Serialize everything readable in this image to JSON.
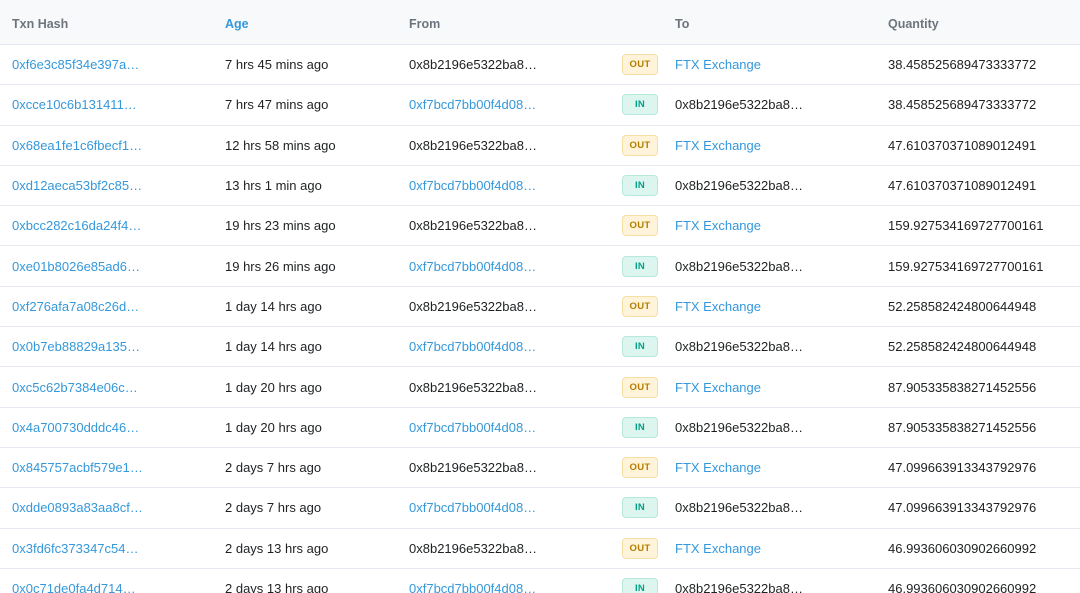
{
  "header": {
    "txn_hash": "Txn Hash",
    "age": "Age",
    "from": "From",
    "to": "To",
    "quantity": "Quantity"
  },
  "colors": {
    "link": "#3498db",
    "out_badge": "#b47d00",
    "in_badge": "#00a186"
  },
  "rows": [
    {
      "hash": "0xf6e3c85f34e397a…",
      "age": "7 hrs 45 mins ago",
      "from": "0x8b2196e5322ba8…",
      "from_link": false,
      "dir": "OUT",
      "to": "FTX Exchange",
      "to_link": true,
      "qty": "38.458525689473333772"
    },
    {
      "hash": "0xcce10c6b131411…",
      "age": "7 hrs 47 mins ago",
      "from": "0xf7bcd7bb00f4d08…",
      "from_link": true,
      "dir": "IN",
      "to": "0x8b2196e5322ba8…",
      "to_link": false,
      "qty": "38.458525689473333772"
    },
    {
      "hash": "0x68ea1fe1c6fbecf1…",
      "age": "12 hrs 58 mins ago",
      "from": "0x8b2196e5322ba8…",
      "from_link": false,
      "dir": "OUT",
      "to": "FTX Exchange",
      "to_link": true,
      "qty": "47.610370371089012491"
    },
    {
      "hash": "0xd12aeca53bf2c85…",
      "age": "13 hrs 1 min ago",
      "from": "0xf7bcd7bb00f4d08…",
      "from_link": true,
      "dir": "IN",
      "to": "0x8b2196e5322ba8…",
      "to_link": false,
      "qty": "47.610370371089012491"
    },
    {
      "hash": "0xbcc282c16da24f4…",
      "age": "19 hrs 23 mins ago",
      "from": "0x8b2196e5322ba8…",
      "from_link": false,
      "dir": "OUT",
      "to": "FTX Exchange",
      "to_link": true,
      "qty": "159.927534169727700161"
    },
    {
      "hash": "0xe01b8026e85ad6…",
      "age": "19 hrs 26 mins ago",
      "from": "0xf7bcd7bb00f4d08…",
      "from_link": true,
      "dir": "IN",
      "to": "0x8b2196e5322ba8…",
      "to_link": false,
      "qty": "159.927534169727700161"
    },
    {
      "hash": "0xf276afa7a08c26d…",
      "age": "1 day 14 hrs ago",
      "from": "0x8b2196e5322ba8…",
      "from_link": false,
      "dir": "OUT",
      "to": "FTX Exchange",
      "to_link": true,
      "qty": "52.258582424800644948"
    },
    {
      "hash": "0x0b7eb88829a135…",
      "age": "1 day 14 hrs ago",
      "from": "0xf7bcd7bb00f4d08…",
      "from_link": true,
      "dir": "IN",
      "to": "0x8b2196e5322ba8…",
      "to_link": false,
      "qty": "52.258582424800644948"
    },
    {
      "hash": "0xc5c62b7384e06c…",
      "age": "1 day 20 hrs ago",
      "from": "0x8b2196e5322ba8…",
      "from_link": false,
      "dir": "OUT",
      "to": "FTX Exchange",
      "to_link": true,
      "qty": "87.905335838271452556"
    },
    {
      "hash": "0x4a700730dddc46…",
      "age": "1 day 20 hrs ago",
      "from": "0xf7bcd7bb00f4d08…",
      "from_link": true,
      "dir": "IN",
      "to": "0x8b2196e5322ba8…",
      "to_link": false,
      "qty": "87.905335838271452556"
    },
    {
      "hash": "0x845757acbf579e1…",
      "age": "2 days 7 hrs ago",
      "from": "0x8b2196e5322ba8…",
      "from_link": false,
      "dir": "OUT",
      "to": "FTX Exchange",
      "to_link": true,
      "qty": "47.099663913343792976"
    },
    {
      "hash": "0xdde0893a83aa8cf…",
      "age": "2 days 7 hrs ago",
      "from": "0xf7bcd7bb00f4d08…",
      "from_link": true,
      "dir": "IN",
      "to": "0x8b2196e5322ba8…",
      "to_link": false,
      "qty": "47.099663913343792976"
    },
    {
      "hash": "0x3fd6fc373347c54…",
      "age": "2 days 13 hrs ago",
      "from": "0x8b2196e5322ba8…",
      "from_link": false,
      "dir": "OUT",
      "to": "FTX Exchange",
      "to_link": true,
      "qty": "46.993606030902660992"
    },
    {
      "hash": "0x0c71de0fa4d714…",
      "age": "2 days 13 hrs ago",
      "from": "0xf7bcd7bb00f4d08…",
      "from_link": true,
      "dir": "IN",
      "to": "0x8b2196e5322ba8…",
      "to_link": false,
      "qty": "46.993606030902660992"
    }
  ]
}
